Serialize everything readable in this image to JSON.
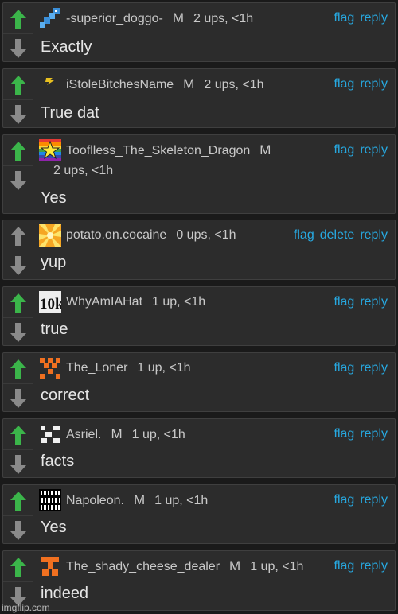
{
  "comments": [
    {
      "username": "-superior_doggo-",
      "mod": "M",
      "ups": "2 ups, <1h",
      "actions": [
        "flag",
        "reply"
      ],
      "text": "Exactly",
      "avatar": "blue-pixel-avatar"
    },
    {
      "username": "iStoleBitchesName",
      "mod": "M",
      "ups": "2 ups, <1h",
      "actions": [
        "flag",
        "reply"
      ],
      "text": "True dat",
      "avatar": "lightning-avatar"
    },
    {
      "username": "Tooflless_The_Skeleton_Dragon",
      "mod": "M",
      "ups": "2 ups, <1h",
      "actions": [
        "flag",
        "reply"
      ],
      "text": "Yes",
      "avatar": "rainbow-star-avatar"
    },
    {
      "username": "potato.on.cocaine",
      "mod": "",
      "ups": "0 ups, <1h",
      "actions": [
        "flag",
        "delete",
        "reply"
      ],
      "text": "yup",
      "avatar": "orange-burst-avatar"
    },
    {
      "username": "WhyAmIAHat",
      "mod": "",
      "ups": "1 up, <1h",
      "actions": [
        "flag",
        "reply"
      ],
      "text": "true",
      "avatar": "10k-avatar",
      "avatar_text": "10k"
    },
    {
      "username": "The_Loner",
      "mod": "",
      "ups": "1 up, <1h",
      "actions": [
        "flag",
        "reply"
      ],
      "text": "correct",
      "avatar": "orange-pixel-avatar"
    },
    {
      "username": "Asriel.",
      "mod": "M",
      "ups": "1 up, <1h",
      "actions": [
        "flag",
        "reply"
      ],
      "text": "facts",
      "avatar": "white-pixel-avatar"
    },
    {
      "username": "Napoleon.",
      "mod": "M",
      "ups": "1 up, <1h",
      "actions": [
        "flag",
        "reply"
      ],
      "text": "Yes",
      "avatar": "binary-avatar",
      "avatar_text": "01001\n01100"
    },
    {
      "username": "The_shady_cheese_dealer",
      "mod": "M",
      "ups": "1 up, <1h",
      "actions": [
        "flag",
        "reply"
      ],
      "text": "indeed",
      "avatar": "orange-figure-avatar"
    }
  ],
  "watermark": "imgflip.com",
  "colors": {
    "upvote": "#3bb54a",
    "downvote": "#8a8a8a",
    "action_link": "#27a9e1",
    "panel": "#2c2c2c"
  }
}
